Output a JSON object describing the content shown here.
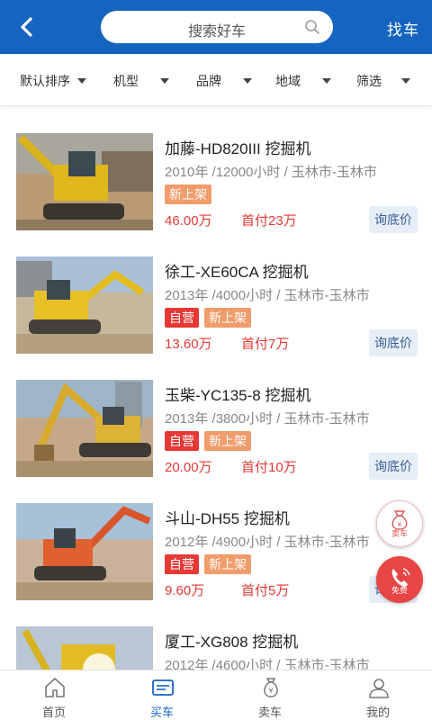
{
  "header": {
    "search_placeholder": "搜索好车",
    "find_label": "找车"
  },
  "filters": [
    "默认排序",
    "机型",
    "品牌",
    "地域",
    "筛选"
  ],
  "listings": [
    {
      "title": "加藤-HD820III 挖掘机",
      "meta": "2010年 /12000小时 /  玉林市-玉林市",
      "tags": [
        {
          "label": "新上架",
          "kind": "new"
        }
      ],
      "price": "46.00万",
      "down": "首付23万",
      "ask": "询底价"
    },
    {
      "title": "徐工-XE60CA 挖掘机",
      "meta": "2013年 /4000小时 /  玉林市-玉林市",
      "tags": [
        {
          "label": "自营",
          "kind": "self"
        },
        {
          "label": "新上架",
          "kind": "new"
        }
      ],
      "price": "13.60万",
      "down": "首付7万",
      "ask": "询底价"
    },
    {
      "title": "玉柴-YC135-8 挖掘机",
      "meta": "2013年 /3800小时 /  玉林市-玉林市",
      "tags": [
        {
          "label": "自营",
          "kind": "self"
        },
        {
          "label": "新上架",
          "kind": "new"
        }
      ],
      "price": "20.00万",
      "down": "首付10万",
      "ask": "询底价"
    },
    {
      "title": "斗山-DH55 挖掘机",
      "meta": "2012年 /4900小时 /  玉林市-玉林市",
      "tags": [
        {
          "label": "自营",
          "kind": "self"
        },
        {
          "label": "新上架",
          "kind": "new"
        }
      ],
      "price": "9.60万",
      "down": "首付5万",
      "ask": "询底价"
    },
    {
      "title": "厦工-XG808 挖掘机",
      "meta": "2012年 /4600小时 /  玉林市-玉林市",
      "tags": [],
      "price": "",
      "down": "",
      "ask": ""
    }
  ],
  "floating": {
    "sell_label": "卖车",
    "call_label": "免费"
  },
  "tabbar": [
    {
      "label": "首页",
      "icon": "home-icon",
      "active": false
    },
    {
      "label": "买车",
      "icon": "buy-car-icon",
      "active": true
    },
    {
      "label": "卖车",
      "icon": "money-bag-icon",
      "active": false
    },
    {
      "label": "我的",
      "icon": "user-icon",
      "active": false
    }
  ],
  "colors": {
    "brand": "#1565c0",
    "price": "#e53935",
    "tag_self": "#e53935",
    "tag_new": "#f09c6b"
  }
}
